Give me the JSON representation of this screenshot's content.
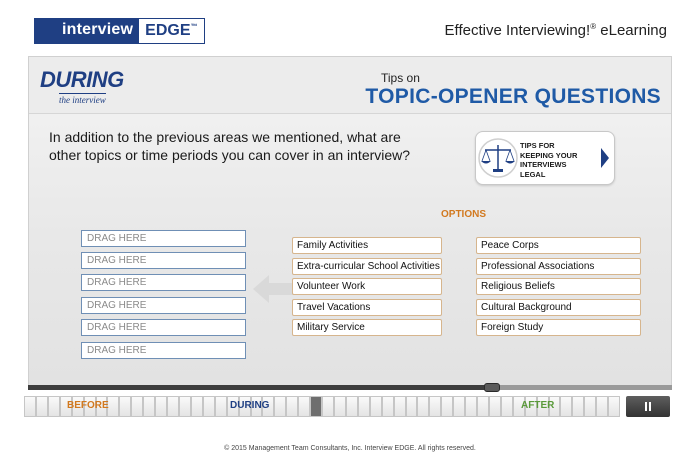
{
  "header": {
    "logo_left": "interview",
    "logo_right": "EDGE",
    "logo_tm": "™",
    "app_title": "Effective Interviewing!",
    "app_title_mark": "®",
    "app_title_suffix": " eLearning"
  },
  "section": {
    "word": "DURING",
    "sub": "the interview",
    "tips_on": "Tips on",
    "title": "TOPIC-OPENER QUESTIONS"
  },
  "question": "In addition to the previous areas we mentioned, what are other topics or time periods you can cover in an interview?",
  "tips_button": {
    "line1": "TIPS FOR",
    "line2": "KEEPING YOUR",
    "line3": "INTERVIEWS",
    "line4": "LEGAL",
    "icon": "scales-icon"
  },
  "options_label": "OPTIONS",
  "drag_slots": [
    "DRAG HERE",
    "DRAG HERE",
    "DRAG HERE",
    "DRAG HERE",
    "DRAG HERE",
    "DRAG HERE"
  ],
  "options_left": [
    "Family Activities",
    "Extra-curricular School Activities",
    "Volunteer Work",
    "Travel Vacations",
    "Military Service"
  ],
  "options_right": [
    "Peace Corps",
    "Professional Associations",
    "Religious Beliefs",
    "Cultural Background",
    "Foreign Study"
  ],
  "timeline": {
    "before": "BEFORE",
    "during": "DURING",
    "after": "AFTER",
    "progress": 0.72
  },
  "colors": {
    "brand_blue": "#1f3f83",
    "title_blue": "#1f5aa6",
    "orange": "#d2791f",
    "green": "#5a9a3a"
  },
  "footer": "© 2015 Management Team Consultants, Inc. Interview EDGE. All rights reserved."
}
